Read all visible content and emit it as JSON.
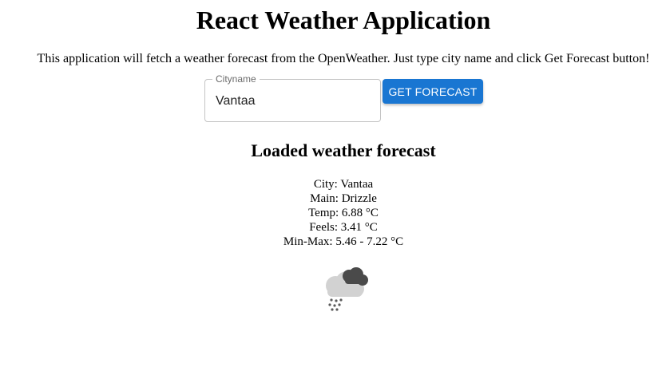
{
  "header": {
    "title": "React Weather Application",
    "description": "This application will fetch a weather forecast from the OpenWeather. Just type city name and click Get Forecast button!"
  },
  "form": {
    "city_label": "Cityname",
    "city_value": "Vantaa",
    "button_label": "GET FORECAST"
  },
  "forecast": {
    "heading": "Loaded weather forecast",
    "city": "City: Vantaa",
    "main": "Main: Drizzle",
    "temp": "Temp: 6.88 °C",
    "feels": "Feels: 3.41 °C",
    "min_max": "Min-Max: 5.46 - 7.22 °C",
    "icon": "drizzle-cloud-icon"
  },
  "colors": {
    "button": "#1976d2",
    "field_border": "#c4c4c4"
  }
}
